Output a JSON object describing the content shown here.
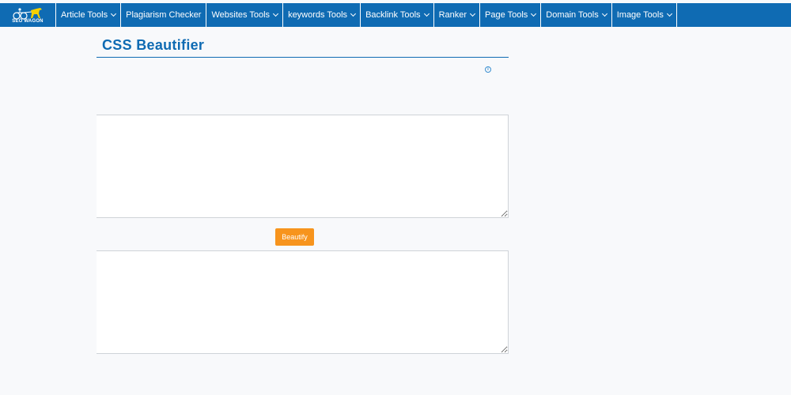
{
  "nav": {
    "logo_text": "SEO WAGON",
    "items": [
      {
        "label": "Article Tools",
        "has_dropdown": true
      },
      {
        "label": "Plagiarism Checker",
        "has_dropdown": false
      },
      {
        "label": "Websites Tools",
        "has_dropdown": true
      },
      {
        "label": "keywords Tools",
        "has_dropdown": true
      },
      {
        "label": "Backlink Tools",
        "has_dropdown": true
      },
      {
        "label": "Ranker",
        "has_dropdown": true
      },
      {
        "label": "Page Tools",
        "has_dropdown": true
      },
      {
        "label": "Domain Tools",
        "has_dropdown": true
      },
      {
        "label": "Image Tools",
        "has_dropdown": true
      }
    ]
  },
  "page": {
    "title": "CSS Beautifier",
    "ad_info_glyph": "i"
  },
  "form": {
    "input_value": "",
    "output_value": "",
    "button_label": "Beautify"
  },
  "colors": {
    "nav_bg": "#0f6bb3",
    "title": "#0f6bb3",
    "button": "#f7941d",
    "page_bg": "#f8f9fb"
  }
}
